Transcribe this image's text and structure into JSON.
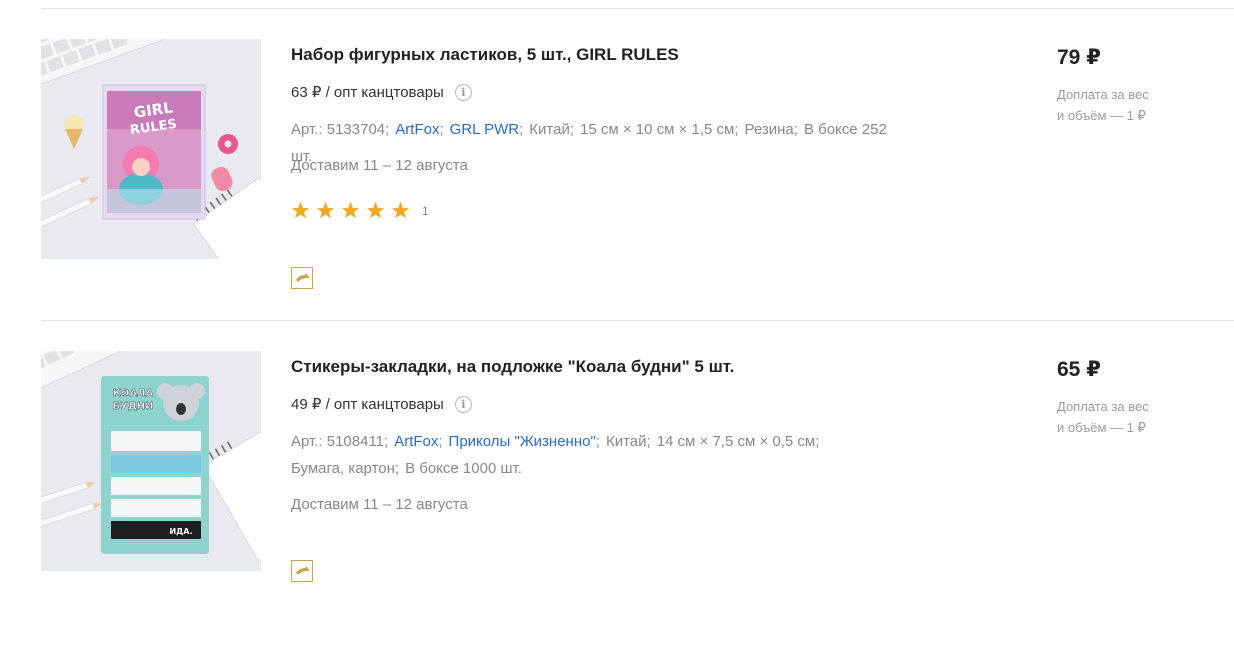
{
  "products": [
    {
      "title": "Набор фигурных ластиков, 5 шт., GIRL RULES",
      "opt_price": "63 ₽ / опт канцтовары",
      "spec_prefix": "Арт.: 5133704",
      "brand": "ArtFox",
      "series": "GRL PWR",
      "country": "Китай",
      "size": "15 см × 10 см × 1,5 см",
      "material": "Резина",
      "box": "В боксе 252 шт.",
      "delivery": "Доставим 11 – 12 августа",
      "rating_count": "1",
      "price": "79 ₽",
      "surcharge_line1": "Доплата за вес",
      "surcharge_line2": "и объём — 1 ₽",
      "image_text": "GIRL RULES"
    },
    {
      "title": "Стикеры-закладки, на подложке \"Коала будни\" 5 шт.",
      "opt_price": "49 ₽ / опт канцтовары",
      "spec_prefix": "Арт.: 5108411",
      "brand": "ArtFox",
      "series": "Приколы \"Жизненно\"",
      "country": "Китай",
      "size": "14 см × 7,5 см × 0,5 см",
      "material": "Бумага, картон",
      "box": "В боксе 1000 шт.",
      "delivery": "Доставим 11 – 12 августа",
      "price": "65 ₽",
      "surcharge_line1": "Доплата за вес",
      "surcharge_line2": "и объём — 1 ₽",
      "image_text": "КОАЛА БУДНИ"
    }
  ],
  "colors": {
    "link": "#2a6cc4",
    "star": "#f5a623",
    "dolphin": "#d0a248"
  },
  "icons": {
    "info": "info-icon",
    "star": "star-icon",
    "dolphin": "dolphin-icon"
  }
}
